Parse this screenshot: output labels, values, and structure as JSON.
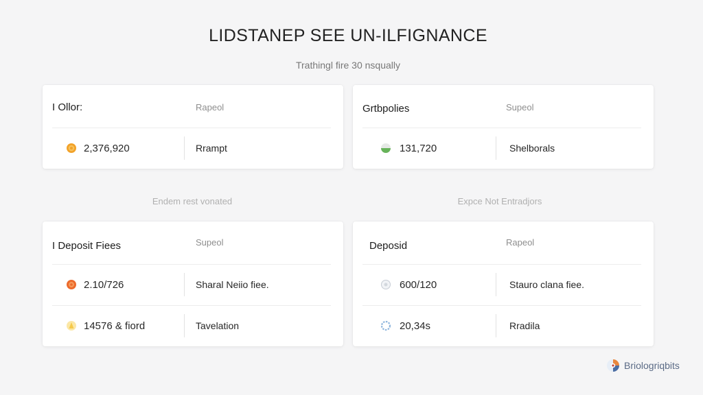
{
  "header": {
    "title": "LIDSTANEP SEE UN-ILFIGNANCE",
    "subtitle": "Trathingl fire 30 nsqually"
  },
  "cards": [
    {
      "title": "I Ollor:",
      "meta": "Rapeol",
      "rows": [
        {
          "icon": "orange-coin-icon",
          "value": "2,376,920",
          "label": "Rrampt"
        }
      ]
    },
    {
      "title": "Grtbpolies",
      "meta": "Supeol",
      "rows": [
        {
          "icon": "green-half-coin-icon",
          "value": "131,720",
          "label": "Shelborals"
        }
      ]
    },
    {
      "title": "I Deposit Fiees",
      "meta": "Supeol",
      "rows": [
        {
          "icon": "orange-red-coin-icon",
          "value": "2.10/726",
          "label": "Sharal Neiio fiee."
        },
        {
          "icon": "yellow-token-icon",
          "value": "14576 & fiord",
          "label": "Tavelation"
        }
      ]
    },
    {
      "title": "Deposid",
      "meta": "Rapeol",
      "rows": [
        {
          "icon": "gray-coin-icon",
          "value": "600/120",
          "label": "Stauro clana fiee."
        },
        {
          "icon": "blue-ring-icon",
          "value": "20,34s",
          "label": "Rradila"
        }
      ]
    }
  ],
  "notes": {
    "left": "Endem rest vonated",
    "right": "Expce Not Entradjors"
  },
  "brand": {
    "text": "Briologriqbits",
    "icon": "brand-logo-icon"
  },
  "colors": {
    "background": "#f5f5f6",
    "card": "#ffffff",
    "orange": "#f2a229",
    "orange_red": "#ec6a2c",
    "green": "#67b35a",
    "yellow": "#f5c94a",
    "blue_ring": "#8fb6dd",
    "brand_text": "#5b6b86"
  }
}
